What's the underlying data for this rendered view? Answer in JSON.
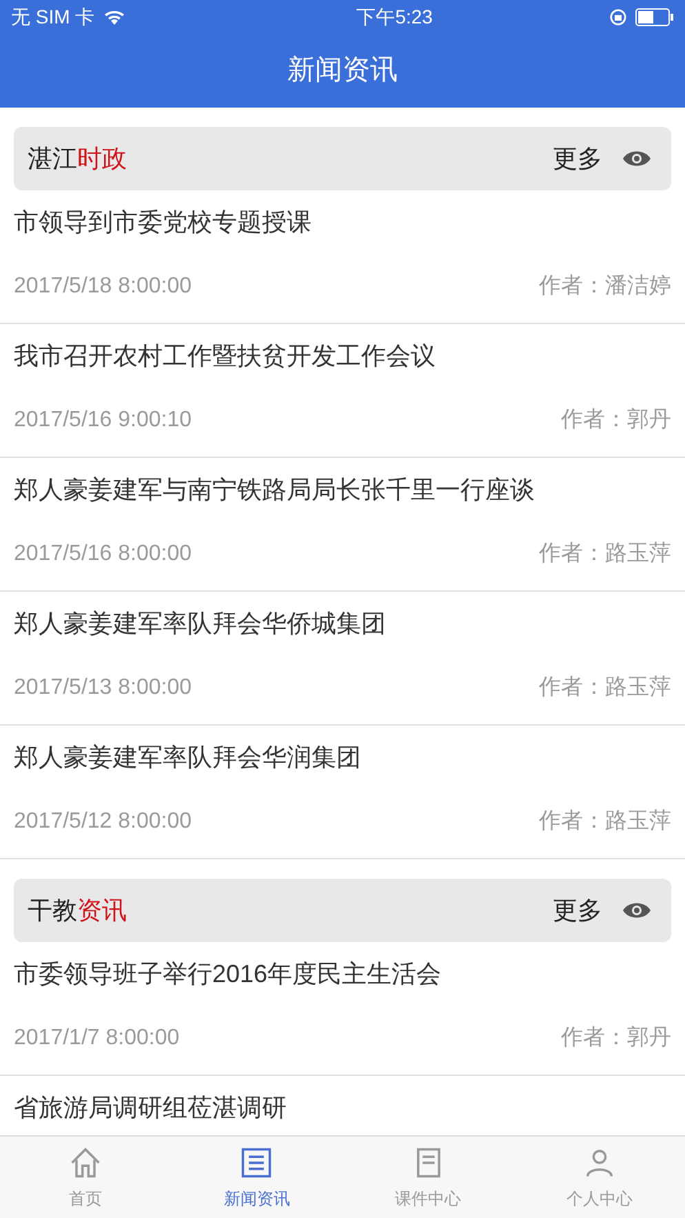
{
  "status_bar": {
    "carrier": "无 SIM 卡",
    "time": "下午5:23"
  },
  "header": {
    "title": "新闻资讯"
  },
  "sections": [
    {
      "title_prefix": "湛江",
      "title_highlight": "时政",
      "more": "更多",
      "items": [
        {
          "title": "市领导到市委党校专题授课",
          "date": "2017/5/18 8:00:00",
          "author": "作者：潘洁婷"
        },
        {
          "title": "我市召开农村工作暨扶贫开发工作会议",
          "date": "2017/5/16 9:00:10",
          "author": "作者：郭丹"
        },
        {
          "title": "郑人豪姜建军与南宁铁路局局长张千里一行座谈",
          "date": "2017/5/16 8:00:00",
          "author": "作者：路玉萍"
        },
        {
          "title": "郑人豪姜建军率队拜会华侨城集团",
          "date": "2017/5/13 8:00:00",
          "author": "作者：路玉萍"
        },
        {
          "title": "郑人豪姜建军率队拜会华润集团",
          "date": "2017/5/12 8:00:00",
          "author": "作者：路玉萍"
        }
      ]
    },
    {
      "title_prefix": "干教",
      "title_highlight": "资讯",
      "more": "更多",
      "items": [
        {
          "title": "市委领导班子举行2016年度民主生活会",
          "date": "2017/1/7 8:00:00",
          "author": "作者：郭丹"
        },
        {
          "title": "省旅游局调研组莅湛调研"
        }
      ]
    }
  ],
  "tabs": [
    {
      "kind": "home",
      "label": "首页",
      "selected": false
    },
    {
      "kind": "news",
      "label": "新闻资讯",
      "selected": true
    },
    {
      "kind": "course",
      "label": "课件中心",
      "selected": false
    },
    {
      "kind": "person",
      "label": "个人中心",
      "selected": false
    }
  ]
}
